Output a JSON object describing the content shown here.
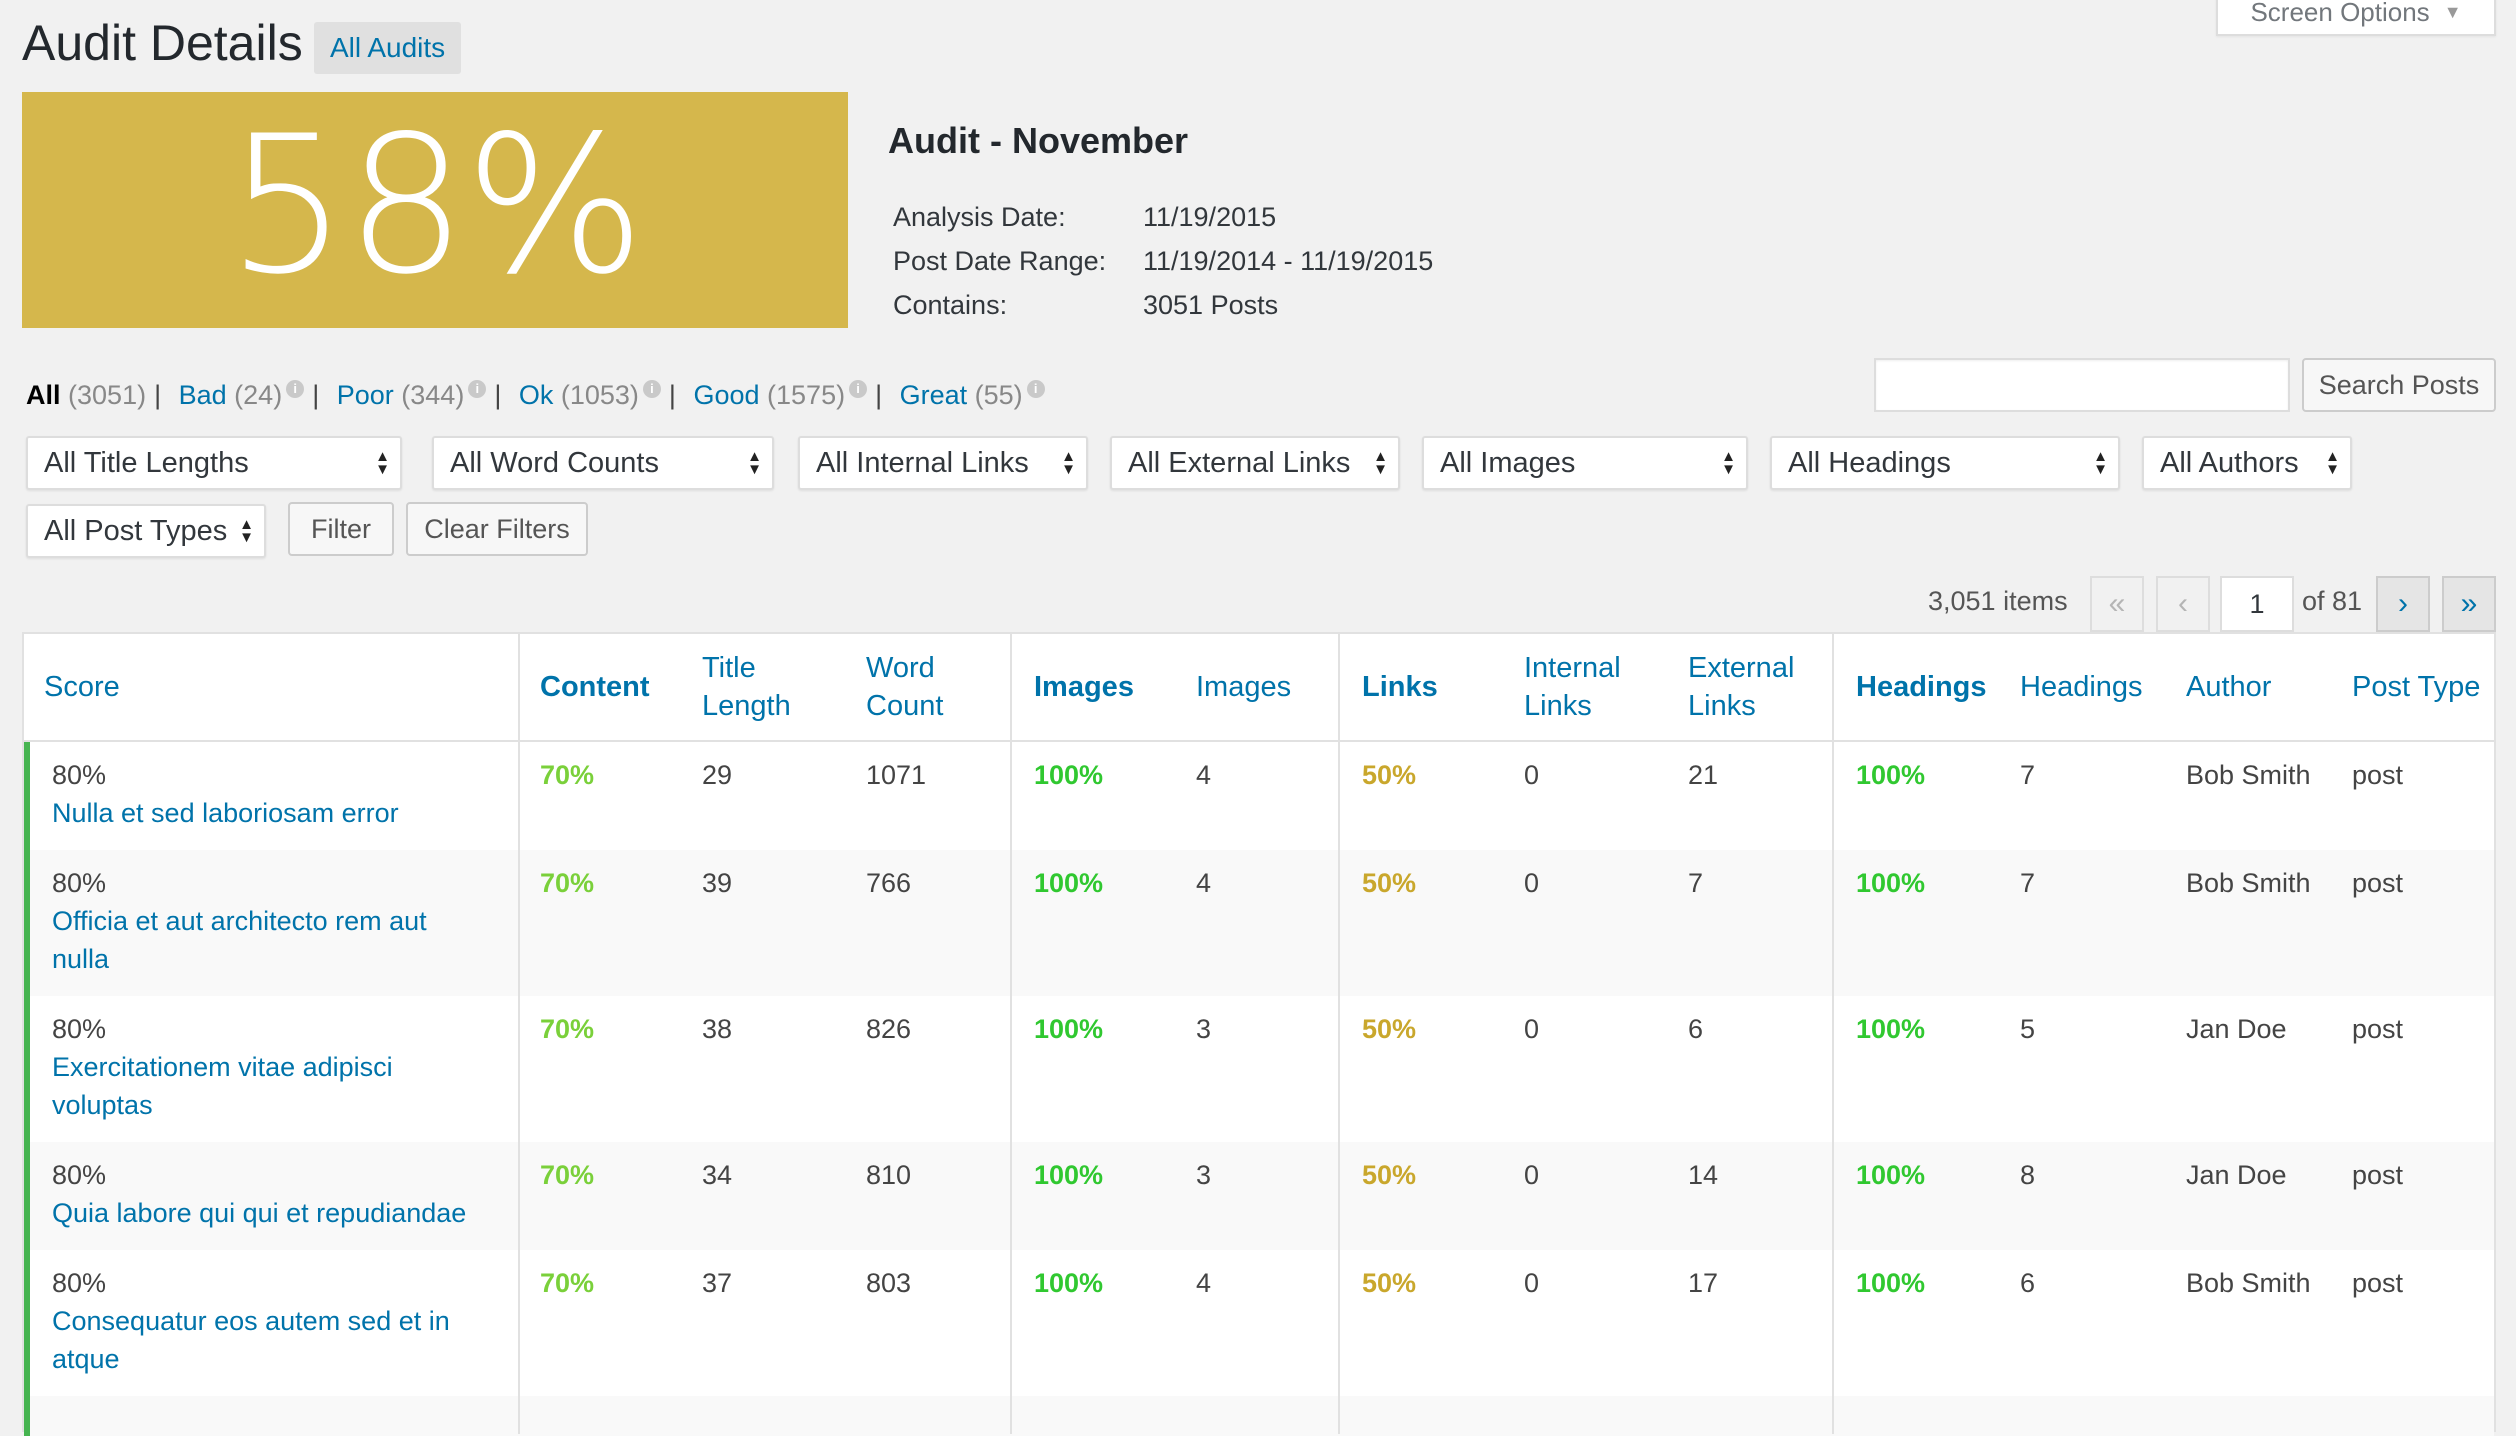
{
  "header": {
    "title": "Audit Details",
    "all_audits_label": "All Audits",
    "screen_options_label": "Screen Options"
  },
  "score": {
    "value": "58%",
    "color": "#d5b74c"
  },
  "audit": {
    "name": "Audit - November",
    "analysis_date_label": "Analysis Date:",
    "analysis_date": "11/19/2015",
    "post_date_range_label": "Post Date Range:",
    "post_date_range": "11/19/2014 - 11/19/2015",
    "contains_label": "Contains:",
    "contains": "3051 Posts"
  },
  "status_links": [
    {
      "label": "All",
      "count": "(3051)"
    },
    {
      "label": "Bad",
      "count": "(24)"
    },
    {
      "label": "Poor",
      "count": "(344)"
    },
    {
      "label": "Ok",
      "count": "(1053)"
    },
    {
      "label": "Good",
      "count": "(1575)"
    },
    {
      "label": "Great",
      "count": "(55)"
    }
  ],
  "search": {
    "placeholder": "",
    "button_label": "Search Posts"
  },
  "filters": {
    "title_lengths": "All Title Lengths",
    "word_counts": "All Word Counts",
    "internal_links": "All Internal Links",
    "external_links": "All External Links",
    "images": "All Images",
    "headings": "All Headings",
    "authors": "All Authors",
    "post_types": "All Post Types",
    "filter_button": "Filter",
    "clear_button": "Clear Filters"
  },
  "pagination": {
    "items": "3,051 items",
    "first": "«",
    "prev": "‹",
    "current_page": "1",
    "of": "of 81",
    "next": "›",
    "last": "»"
  },
  "table": {
    "columns": {
      "score": "Score",
      "content": "Content",
      "title_length_1": "Title",
      "title_length_2": "Length",
      "word_count_1": "Word",
      "word_count_2": "Count",
      "images_score": "Images",
      "images": "Images",
      "links_score": "Links",
      "internal_links_1": "Internal",
      "internal_links_2": "Links",
      "external_links_1": "External",
      "external_links_2": "Links",
      "headings_score": "Headings",
      "headings": "Headings",
      "author": "Author",
      "post_type": "Post Type"
    },
    "rows": [
      {
        "score": "80%",
        "title": "Nulla et sed laboriosam error",
        "content": "70%",
        "title_length": "29",
        "word_count": "1071",
        "images_score": "100%",
        "images": "4",
        "links_score": "50%",
        "internal_links": "0",
        "external_links": "21",
        "headings_score": "100%",
        "headings": "7",
        "author": "Bob Smith",
        "post_type": "post"
      },
      {
        "score": "80%",
        "title": "Officia et aut architecto rem aut nulla",
        "content": "70%",
        "title_length": "39",
        "word_count": "766",
        "images_score": "100%",
        "images": "4",
        "links_score": "50%",
        "internal_links": "0",
        "external_links": "7",
        "headings_score": "100%",
        "headings": "7",
        "author": "Bob Smith",
        "post_type": "post"
      },
      {
        "score": "80%",
        "title": "Exercitationem vitae adipisci voluptas",
        "content": "70%",
        "title_length": "38",
        "word_count": "826",
        "images_score": "100%",
        "images": "3",
        "links_score": "50%",
        "internal_links": "0",
        "external_links": "6",
        "headings_score": "100%",
        "headings": "5",
        "author": "Jan Doe",
        "post_type": "post"
      },
      {
        "score": "80%",
        "title": "Quia labore qui qui et repudiandae",
        "content": "70%",
        "title_length": "34",
        "word_count": "810",
        "images_score": "100%",
        "images": "3",
        "links_score": "50%",
        "internal_links": "0",
        "external_links": "14",
        "headings_score": "100%",
        "headings": "8",
        "author": "Jan Doe",
        "post_type": "post"
      },
      {
        "score": "80%",
        "title": "Consequatur eos autem sed et in atque",
        "content": "70%",
        "title_length": "37",
        "word_count": "803",
        "images_score": "100%",
        "images": "4",
        "links_score": "50%",
        "internal_links": "0",
        "external_links": "17",
        "headings_score": "100%",
        "headings": "6",
        "author": "Bob Smith",
        "post_type": "post"
      }
    ]
  },
  "colors": {
    "link": "#0073aa",
    "great": "#30c830",
    "good": "#7ad03a",
    "ok": "#c9a72c",
    "row_bar": "#46b450"
  }
}
